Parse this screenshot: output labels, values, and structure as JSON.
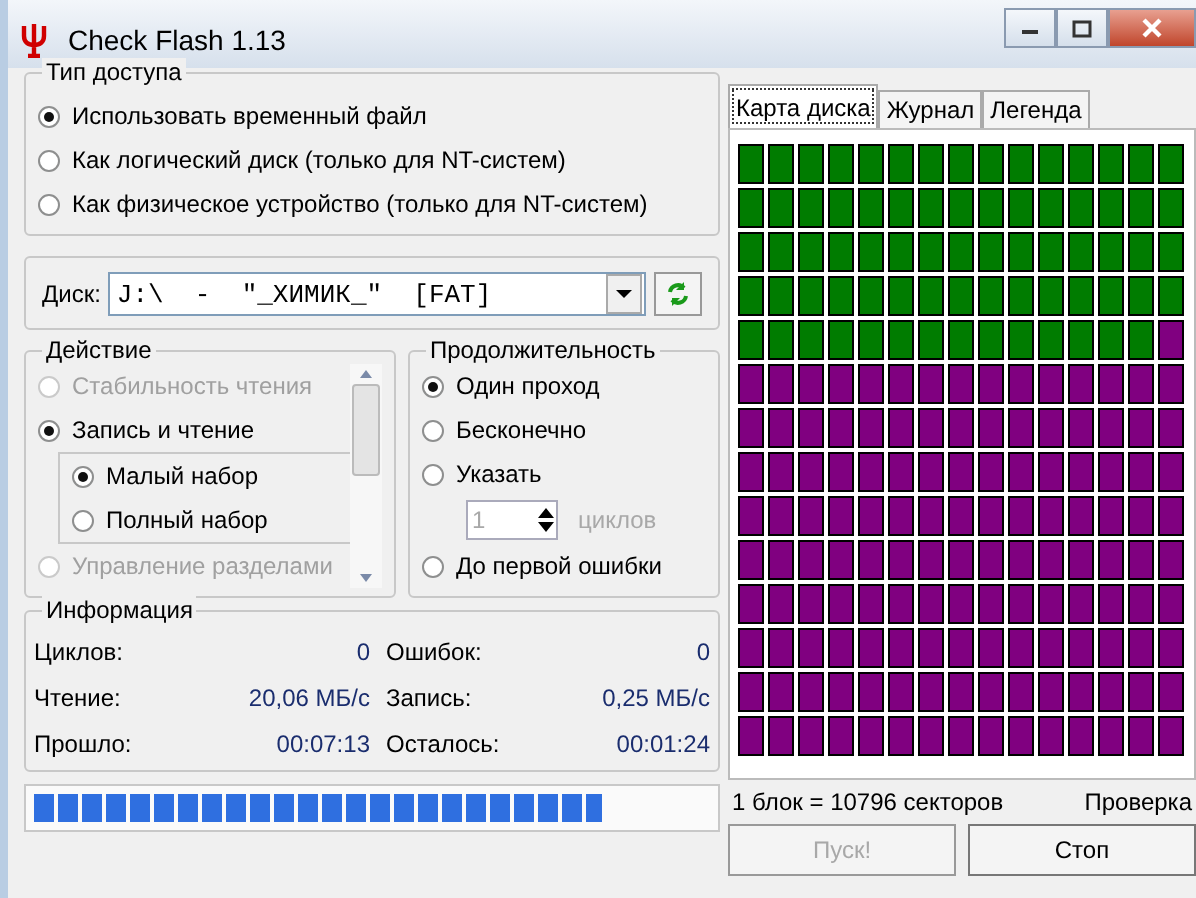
{
  "window": {
    "title": "Check Flash 1.13"
  },
  "access_type": {
    "title": "Тип доступа",
    "options": [
      {
        "label": "Использовать временный файл",
        "selected": true
      },
      {
        "label": "Как логический диск (только для NT-систем)",
        "selected": false
      },
      {
        "label": "Как физическое устройство (только для NT-систем)",
        "selected": false
      }
    ]
  },
  "disk": {
    "label": "Диск:",
    "value": "J:\\  -  \"_ХИМИК_\"  [FAT]"
  },
  "action": {
    "title": "Действие",
    "items": [
      {
        "label": "Стабильность чтения",
        "selected": false,
        "disabled": true
      },
      {
        "label": "Запись и чтение",
        "selected": true,
        "disabled": false,
        "children": [
          {
            "label": "Малый набор",
            "selected": true,
            "disabled": false
          },
          {
            "label": "Полный набор",
            "selected": false,
            "disabled": false
          }
        ]
      },
      {
        "label": "Управление разделами",
        "selected": false,
        "disabled": true
      }
    ]
  },
  "duration": {
    "title": "Продолжительность",
    "options": [
      {
        "label": "Один проход",
        "selected": true
      },
      {
        "label": "Бесконечно",
        "selected": false
      },
      {
        "label": "Указать",
        "selected": false,
        "spin": {
          "value": "1",
          "unit": "циклов",
          "disabled": true
        }
      },
      {
        "label": "До первой ошибки",
        "selected": false
      }
    ]
  },
  "info": {
    "title": "Информация",
    "rows": [
      [
        {
          "label": "Циклов:",
          "value": "0"
        },
        {
          "label": "Ошибок:",
          "value": "0"
        }
      ],
      [
        {
          "label": "Чтение:",
          "value": "20,06 МБ/с"
        },
        {
          "label": "Запись:",
          "value": "0,25 МБ/с"
        }
      ],
      [
        {
          "label": "Прошло:",
          "value": "00:07:13"
        },
        {
          "label": "Осталось:",
          "value": "00:01:24"
        }
      ]
    ]
  },
  "progress": {
    "level": 0.84
  },
  "tabs": [
    {
      "label": "Карта диска",
      "selected": true
    },
    {
      "label": "Журнал",
      "selected": false
    },
    {
      "label": "Легенда",
      "selected": false
    }
  ],
  "block_map": {
    "rows": [
      {
        "cells": [
          {
            "done": true
          },
          {
            "done": true
          },
          {
            "done": true
          },
          {
            "done": true
          },
          {
            "done": true
          },
          {
            "done": true
          },
          {
            "done": true
          },
          {
            "done": true
          },
          {
            "done": true
          },
          {
            "done": true
          },
          {
            "done": true
          },
          {
            "done": true
          },
          {
            "done": true
          },
          {
            "done": true
          },
          {
            "done": true
          }
        ]
      },
      {
        "cells": [
          {
            "done": true
          },
          {
            "done": true
          },
          {
            "done": true
          },
          {
            "done": true
          },
          {
            "done": true
          },
          {
            "done": true
          },
          {
            "done": true
          },
          {
            "done": true
          },
          {
            "done": true
          },
          {
            "done": true
          },
          {
            "done": true
          },
          {
            "done": true
          },
          {
            "done": true
          },
          {
            "done": true
          },
          {
            "done": true
          }
        ]
      },
      {
        "cells": [
          {
            "done": true
          },
          {
            "done": true
          },
          {
            "done": true
          },
          {
            "done": true
          },
          {
            "done": true
          },
          {
            "done": true
          },
          {
            "done": true
          },
          {
            "done": true
          },
          {
            "done": true
          },
          {
            "done": true
          },
          {
            "done": true
          },
          {
            "done": true
          },
          {
            "done": true
          },
          {
            "done": true
          },
          {
            "done": true
          }
        ]
      },
      {
        "cells": [
          {
            "done": true
          },
          {
            "done": true
          },
          {
            "done": true
          },
          {
            "done": true
          },
          {
            "done": true
          },
          {
            "done": true
          },
          {
            "done": true
          },
          {
            "done": true
          },
          {
            "done": true
          },
          {
            "done": true
          },
          {
            "done": true
          },
          {
            "done": true
          },
          {
            "done": true
          },
          {
            "done": true
          },
          {
            "done": true
          }
        ]
      },
      {
        "cells": [
          {
            "done": true
          },
          {
            "done": true
          },
          {
            "done": true
          },
          {
            "done": true
          },
          {
            "done": true
          },
          {
            "done": true
          },
          {
            "done": true
          },
          {
            "done": true
          },
          {
            "done": true
          },
          {
            "done": true
          },
          {
            "done": true
          },
          {
            "done": true
          },
          {
            "done": true
          },
          {
            "done": true
          },
          {
            "done": false
          }
        ]
      },
      {
        "cells": [
          {
            "done": false
          },
          {
            "done": false
          },
          {
            "done": false
          },
          {
            "done": false
          },
          {
            "done": false
          },
          {
            "done": false
          },
          {
            "done": false
          },
          {
            "done": false
          },
          {
            "done": false
          },
          {
            "done": false
          },
          {
            "done": false
          },
          {
            "done": false
          },
          {
            "done": false
          },
          {
            "done": false
          },
          {
            "done": false
          }
        ]
      },
      {
        "cells": [
          {
            "done": false
          },
          {
            "done": false
          },
          {
            "done": false
          },
          {
            "done": false
          },
          {
            "done": false
          },
          {
            "done": false
          },
          {
            "done": false
          },
          {
            "done": false
          },
          {
            "done": false
          },
          {
            "done": false
          },
          {
            "done": false
          },
          {
            "done": false
          },
          {
            "done": false
          },
          {
            "done": false
          },
          {
            "done": false
          }
        ]
      },
      {
        "cells": [
          {
            "done": false
          },
          {
            "done": false
          },
          {
            "done": false
          },
          {
            "done": false
          },
          {
            "done": false
          },
          {
            "done": false
          },
          {
            "done": false
          },
          {
            "done": false
          },
          {
            "done": false
          },
          {
            "done": false
          },
          {
            "done": false
          },
          {
            "done": false
          },
          {
            "done": false
          },
          {
            "done": false
          },
          {
            "done": false
          }
        ]
      },
      {
        "cells": [
          {
            "done": false
          },
          {
            "done": false
          },
          {
            "done": false
          },
          {
            "done": false
          },
          {
            "done": false
          },
          {
            "done": false
          },
          {
            "done": false
          },
          {
            "done": false
          },
          {
            "done": false
          },
          {
            "done": false
          },
          {
            "done": false
          },
          {
            "done": false
          },
          {
            "done": false
          },
          {
            "done": false
          },
          {
            "done": false
          }
        ]
      },
      {
        "cells": [
          {
            "done": false
          },
          {
            "done": false
          },
          {
            "done": false
          },
          {
            "done": false
          },
          {
            "done": false
          },
          {
            "done": false
          },
          {
            "done": false
          },
          {
            "done": false
          },
          {
            "done": false
          },
          {
            "done": false
          },
          {
            "done": false
          },
          {
            "done": false
          },
          {
            "done": false
          },
          {
            "done": false
          },
          {
            "done": false
          }
        ]
      },
      {
        "cells": [
          {
            "done": false
          },
          {
            "done": false
          },
          {
            "done": false
          },
          {
            "done": false
          },
          {
            "done": false
          },
          {
            "done": false
          },
          {
            "done": false
          },
          {
            "done": false
          },
          {
            "done": false
          },
          {
            "done": false
          },
          {
            "done": false
          },
          {
            "done": false
          },
          {
            "done": false
          },
          {
            "done": false
          },
          {
            "done": false
          }
        ]
      },
      {
        "cells": [
          {
            "done": false
          },
          {
            "done": false
          },
          {
            "done": false
          },
          {
            "done": false
          },
          {
            "done": false
          },
          {
            "done": false
          },
          {
            "done": false
          },
          {
            "done": false
          },
          {
            "done": false
          },
          {
            "done": false
          },
          {
            "done": false
          },
          {
            "done": false
          },
          {
            "done": false
          },
          {
            "done": false
          },
          {
            "done": false
          }
        ]
      },
      {
        "cells": [
          {
            "done": false
          },
          {
            "done": false
          },
          {
            "done": false
          },
          {
            "done": false
          },
          {
            "done": false
          },
          {
            "done": false
          },
          {
            "done": false
          },
          {
            "done": false
          },
          {
            "done": false
          },
          {
            "done": false
          },
          {
            "done": false
          },
          {
            "done": false
          },
          {
            "done": false
          },
          {
            "done": false
          },
          {
            "done": false
          }
        ]
      },
      {
        "cells": [
          {
            "done": false
          },
          {
            "done": false
          },
          {
            "done": false
          },
          {
            "done": false
          },
          {
            "done": false
          },
          {
            "done": false
          },
          {
            "done": false
          },
          {
            "done": false
          },
          {
            "done": false
          },
          {
            "done": false
          },
          {
            "done": false
          },
          {
            "done": false
          },
          {
            "done": false
          },
          {
            "done": false
          },
          {
            "done": false
          }
        ]
      }
    ]
  },
  "block_size": "1 блок = 10796 секторов",
  "status": "Проверка",
  "buttons": [
    {
      "label": "Пуск!",
      "disabled": true
    },
    {
      "label": "Стоп",
      "disabled": false
    }
  ]
}
